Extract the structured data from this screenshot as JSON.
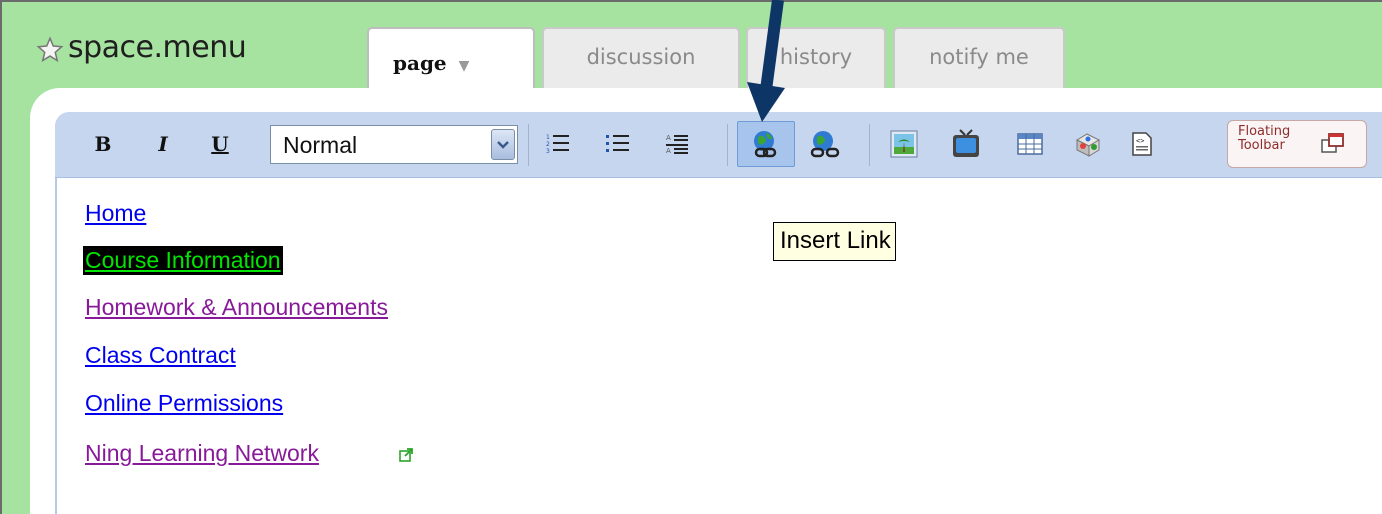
{
  "header": {
    "title": "space.menu",
    "tabs": {
      "page": "page",
      "discussion": "discussion",
      "history": "history",
      "notify": "notify me"
    }
  },
  "toolbar": {
    "bold": "B",
    "italic": "I",
    "underline": "U",
    "format_value": "Normal",
    "floating_toolbar_label": "Floating\nToolbar"
  },
  "tooltip": "Insert Link",
  "links": [
    {
      "label": "Home",
      "visited": false
    },
    {
      "label": "Course Information",
      "visited": false
    },
    {
      "label": "Homework & Announcements",
      "visited": true
    },
    {
      "label": "Class Contract",
      "visited": false
    },
    {
      "label": "Online Permissions",
      "visited": false
    },
    {
      "label": "Ning Learning Network",
      "visited": true
    }
  ],
  "icons": [
    "star-icon",
    "ordered-list-icon",
    "unordered-list-icon",
    "definition-list-icon",
    "insert-link-icon",
    "unlink-icon",
    "insert-image-icon",
    "insert-video-icon",
    "insert-table-icon",
    "insert-widget-icon",
    "insert-code-icon",
    "external-link-icon"
  ],
  "colors": {
    "header_bg": "#a6e3a0",
    "toolbar_bg": "#c6d6ef",
    "link": "#0000ee",
    "visited_link": "#881a9a",
    "highlight_bg": "#000000",
    "highlight_text": "#00e600",
    "annotation_arrow": "#0d3566"
  }
}
